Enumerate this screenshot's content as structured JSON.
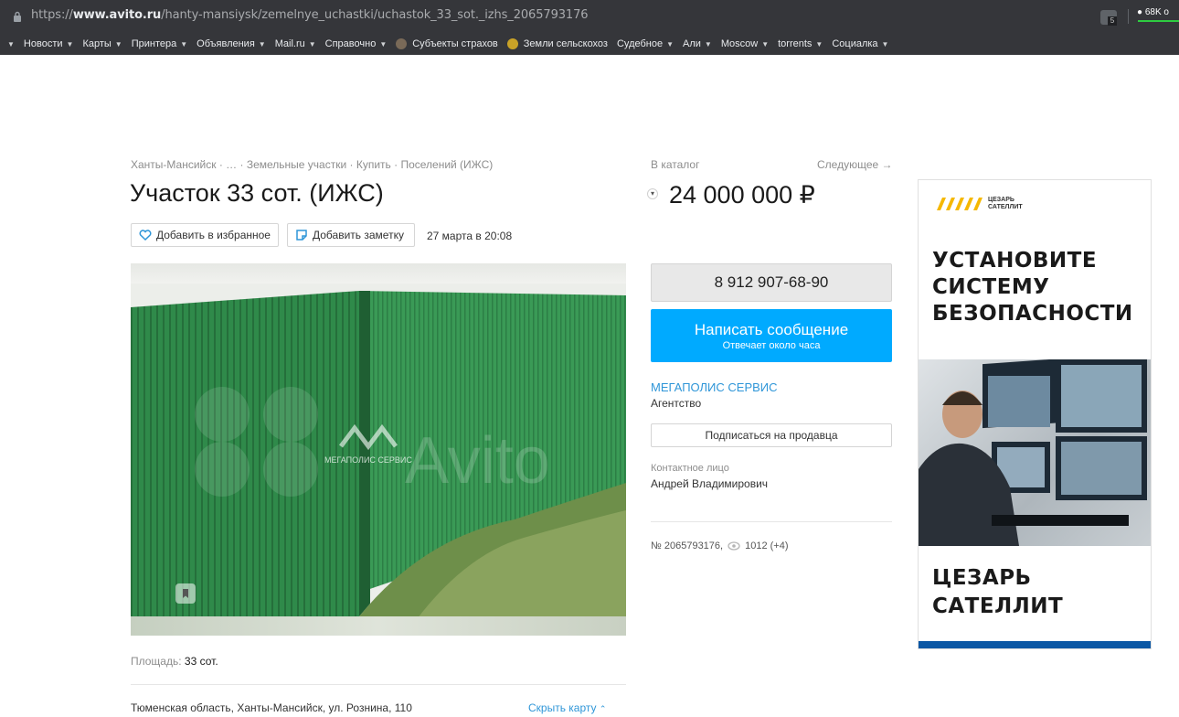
{
  "browser": {
    "url_scheme": "https://",
    "url_domain": "www.avito.ru",
    "url_path": "/hanty-mansiysk/zemelnye_uchastki/uchastok_33_sot._izhs_2065793176",
    "chat_badge": "68K о",
    "ext_badge": "5",
    "bookmarks": [
      {
        "label": "Новости",
        "caret": "▼"
      },
      {
        "label": "Карты",
        "caret": "▼"
      },
      {
        "label": "Принтера",
        "caret": "▼"
      },
      {
        "label": "Объявления",
        "caret": "▼"
      },
      {
        "label": "Mail.ru",
        "caret": "▼"
      },
      {
        "label": "Справочно",
        "caret": "▼"
      },
      {
        "label": "Субъекты страхов",
        "caret": ""
      },
      {
        "label": "Земли сельскохоз",
        "caret": ""
      },
      {
        "label": "Судебное",
        "caret": "▼"
      },
      {
        "label": "Али",
        "caret": "▼"
      },
      {
        "label": "Moscow",
        "caret": "▼"
      },
      {
        "label": "torrents",
        "caret": "▼"
      },
      {
        "label": "Социалка",
        "caret": "▼"
      }
    ]
  },
  "listing": {
    "breadcrumbs": "Ханты-Мансийск · … · Земельные участки · Купить · Поселений (ИЖС)",
    "title": "Участок 33 сот. (ИЖС)",
    "add_favorite": "Добавить в избранное",
    "add_note": "Добавить заметку",
    "date": "27 марта в 20:08",
    "watermark_brand": "МЕГАПОЛИС СЕРВИС",
    "watermark_avito": "Avito",
    "area_label": "Площадь:",
    "area_value": "33 сот.",
    "address": "Тюменская область, Ханты-Мансийск, ул. Рознина, 110",
    "hide_map": "Скрыть карту"
  },
  "sidebar": {
    "catalog": "В каталог",
    "next": "Следующее →",
    "price": "24 000 000 ₽",
    "phone": "8 912 907-68-90",
    "message_main": "Написать сообщение",
    "message_sub": "Отвечает около часа",
    "seller_name": "МЕГАПОЛИС СЕРВИС",
    "seller_type": "Агентство",
    "subscribe": "Подписаться на продавца",
    "contact_label": "Контактное лицо",
    "contact_name": "Андрей Владимирович",
    "item_number": "№ 2065793176,",
    "views": "1012 (+4)"
  },
  "ad": {
    "logo_line1": "ЦЕЗАРЬ",
    "logo_line2": "САТЕЛЛИТ",
    "headline_1": "УСТАНОВИТЕ",
    "headline_2": "СИСТЕМУ",
    "headline_3": "БЕЗОПАСНОСТИ",
    "brand_1": "ЦЕЗАРЬ",
    "brand_2": "САТЕЛЛИТ"
  },
  "colors": {
    "link": "#2f96d8",
    "message_button": "#00aaff",
    "ad_bar": "#0b57a4"
  }
}
